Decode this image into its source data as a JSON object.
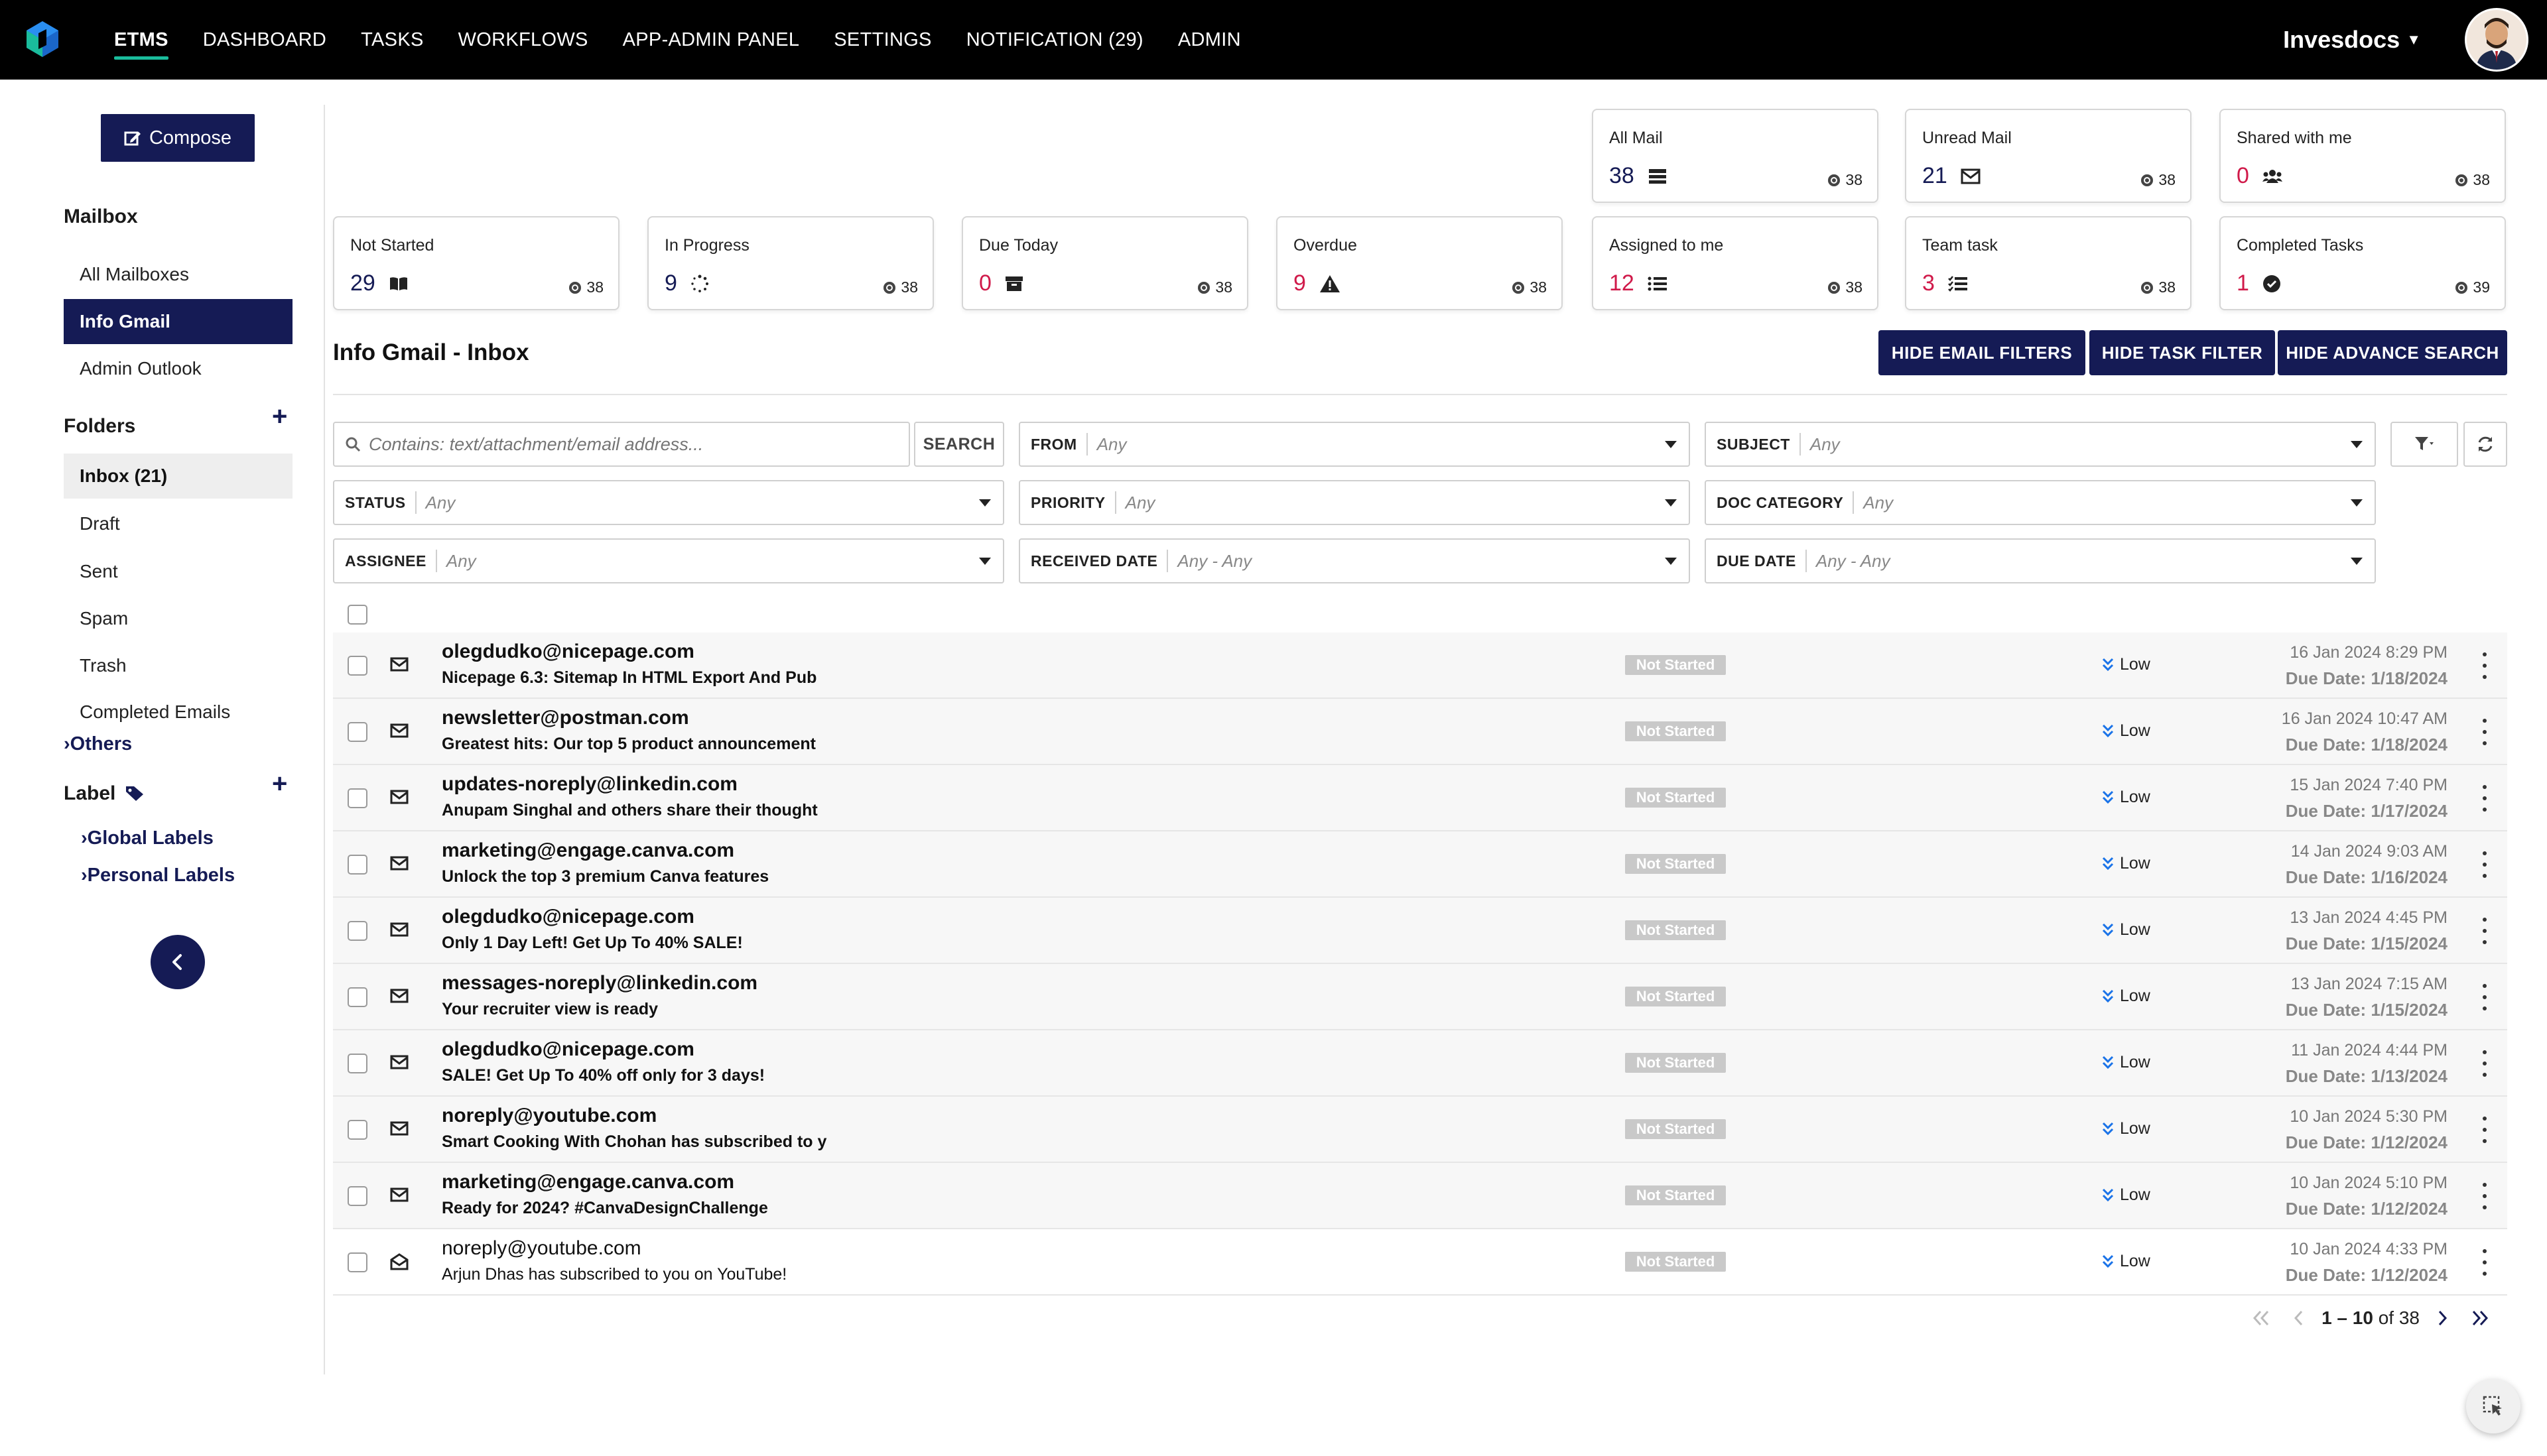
{
  "nav": {
    "items": [
      "ETMS",
      "DASHBOARD",
      "TASKS",
      "WORKFLOWS",
      "APP-ADMIN PANEL",
      "SETTINGS",
      "NOTIFICATION (29)",
      "ADMIN"
    ],
    "brand": "Invesdocs",
    "accent": "#1abc9c"
  },
  "sidebar": {
    "compose": "Compose",
    "mailbox_heading": "Mailbox",
    "mailboxes": [
      "All Mailboxes",
      "Info Gmail",
      "Admin Outlook"
    ],
    "folders_heading": "Folders",
    "folders": [
      "Inbox (21)",
      "Draft",
      "Sent",
      "Spam",
      "Trash",
      "Completed Emails"
    ],
    "others": "Others",
    "label_heading": "Label",
    "labels": [
      "Global Labels",
      "Personal Labels"
    ]
  },
  "cards": {
    "all_mail": {
      "title": "All Mail",
      "value": "38",
      "count": "38"
    },
    "unread_mail": {
      "title": "Unread Mail",
      "value": "21",
      "count": "38"
    },
    "shared": {
      "title": "Shared with me",
      "value": "0",
      "count": "38"
    },
    "not_started": {
      "title": "Not Started",
      "value": "29",
      "count": "38"
    },
    "in_progress": {
      "title": "In Progress",
      "value": "9",
      "count": "38"
    },
    "due_today": {
      "title": "Due Today",
      "value": "0",
      "count": "38"
    },
    "overdue": {
      "title": "Overdue",
      "value": "9",
      "count": "38"
    },
    "assigned": {
      "title": "Assigned to me",
      "value": "12",
      "count": "38"
    },
    "team_task": {
      "title": "Team task",
      "value": "3",
      "count": "38"
    },
    "completed": {
      "title": "Completed Tasks",
      "value": "1",
      "count": "39"
    }
  },
  "main": {
    "title": "Info Gmail - Inbox",
    "btn_email_filters": "HIDE EMAIL FILTERS",
    "btn_task_filter": "HIDE TASK FILTER",
    "btn_adv_search": "HIDE ADVANCE SEARCH"
  },
  "filters": {
    "search_placeholder": "Contains: text/attachment/email address...",
    "search_btn": "SEARCH",
    "from": {
      "label": "FROM",
      "value": "Any"
    },
    "subject": {
      "label": "SUBJECT",
      "value": "Any"
    },
    "status": {
      "label": "STATUS",
      "value": "Any"
    },
    "priority": {
      "label": "PRIORITY",
      "value": "Any"
    },
    "doc_category": {
      "label": "DOC CATEGORY",
      "value": "Any"
    },
    "assignee": {
      "label": "ASSIGNEE",
      "value": "Any"
    },
    "received_date": {
      "label": "RECEIVED DATE",
      "value": "Any - Any"
    },
    "due_date": {
      "label": "DUE DATE",
      "value": "Any - Any"
    }
  },
  "emails": [
    {
      "from": "olegdudko@nicepage.com",
      "subject": "Nicepage 6.3: Sitemap In HTML Export And Pub",
      "status": "Not Started",
      "priority": "Low",
      "date": "16 Jan 2024 8:29 PM",
      "due": "Due Date: 1/18/2024"
    },
    {
      "from": "newsletter@postman.com",
      "subject": "Greatest hits: Our top 5 product announcement",
      "status": "Not Started",
      "priority": "Low",
      "date": "16 Jan 2024 10:47 AM",
      "due": "Due Date: 1/18/2024"
    },
    {
      "from": "updates-noreply@linkedin.com",
      "subject": "Anupam Singhal and others share their thought",
      "status": "Not Started",
      "priority": "Low",
      "date": "15 Jan 2024 7:40 PM",
      "due": "Due Date: 1/17/2024"
    },
    {
      "from": "marketing@engage.canva.com",
      "subject": "Unlock the top 3 premium Canva features",
      "status": "Not Started",
      "priority": "Low",
      "date": "14 Jan 2024 9:03 AM",
      "due": "Due Date: 1/16/2024"
    },
    {
      "from": "olegdudko@nicepage.com",
      "subject": "Only 1 Day Left! Get Up To 40% SALE!",
      "status": "Not Started",
      "priority": "Low",
      "date": "13 Jan 2024 4:45 PM",
      "due": "Due Date: 1/15/2024"
    },
    {
      "from": "messages-noreply@linkedin.com",
      "subject": "Your recruiter view is ready",
      "status": "Not Started",
      "priority": "Low",
      "date": "13 Jan 2024 7:15 AM",
      "due": "Due Date: 1/15/2024"
    },
    {
      "from": "olegdudko@nicepage.com",
      "subject": "SALE! Get Up To 40% off only for 3 days!",
      "status": "Not Started",
      "priority": "Low",
      "date": "11 Jan 2024 4:44 PM",
      "due": "Due Date: 1/13/2024"
    },
    {
      "from": "noreply@youtube.com",
      "subject": "Smart Cooking With Chohan has subscribed to y",
      "status": "Not Started",
      "priority": "Low",
      "date": "10 Jan 2024 5:30 PM",
      "due": "Due Date: 1/12/2024"
    },
    {
      "from": "marketing@engage.canva.com",
      "subject": "Ready for 2024? #CanvaDesignChallenge",
      "status": "Not Started",
      "priority": "Low",
      "date": "10 Jan 2024 5:10 PM",
      "due": "Due Date: 1/12/2024"
    },
    {
      "from": "noreply@youtube.com",
      "subject": "Arjun Dhas has subscribed to you on YouTube!",
      "status": "Not Started",
      "priority": "Low",
      "date": "10 Jan 2024 4:33 PM",
      "due": "Due Date: 1/12/2024"
    }
  ],
  "pager": {
    "range": "1 – 10",
    "of": "of 38"
  },
  "colors": {
    "primary": "#151b55",
    "red": "#d01a4a",
    "status_gray": "#c9c9c9",
    "priority_blue": "#1a73e8"
  }
}
